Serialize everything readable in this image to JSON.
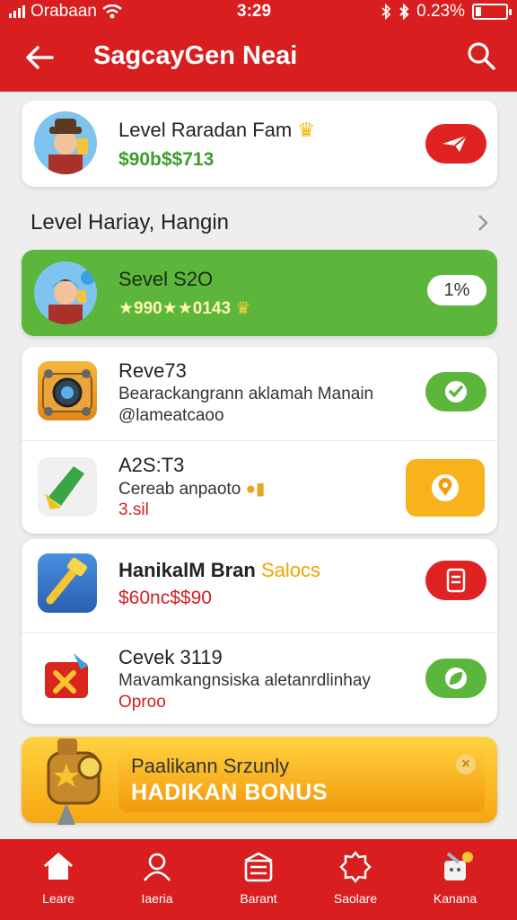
{
  "status": {
    "carrier": "Orabaan",
    "time": "3:29",
    "battery": "0.23%"
  },
  "header": {
    "title": "SagcayGen Neai"
  },
  "top_card": {
    "name": "Level Raradan Fam",
    "price": "$90b$$713"
  },
  "section": {
    "title": "Level Hariay, Hangin"
  },
  "highlight": {
    "name": "Sevel S2O",
    "stats": "★990★★0143",
    "badge": "1%"
  },
  "group1": [
    {
      "name": "Reve73",
      "line1": "Bearackangrann aklamah Manain",
      "line2": "@lameatcaoo"
    },
    {
      "name": "A2S:T3",
      "line1": "Cereab anpaoto",
      "line2": "3.sil"
    }
  ],
  "group2": [
    {
      "name": "HanikalM Bran",
      "tag": "Salocs",
      "line1": "$60nc$$90"
    },
    {
      "name": "Cevek 3119",
      "line1": "Mavamkangnsiska aletanrdlinhay",
      "line2": "Oproo"
    }
  ],
  "promo": {
    "title": "Paalikann Srzunly",
    "bonus": "HADIKAN BONUS",
    "close": "×"
  },
  "tabs": [
    {
      "label": "Leare",
      "icon": "home-icon"
    },
    {
      "label": "Iaeria",
      "icon": "person-icon"
    },
    {
      "label": "Barant",
      "icon": "wallet-icon"
    },
    {
      "label": "Saolare",
      "icon": "gear-icon"
    },
    {
      "label": "Kanana",
      "icon": "gift-icon"
    }
  ],
  "colors": {
    "brand_red": "#d81e1e",
    "green": "#5cb63c",
    "yellow": "#f7b21c"
  }
}
